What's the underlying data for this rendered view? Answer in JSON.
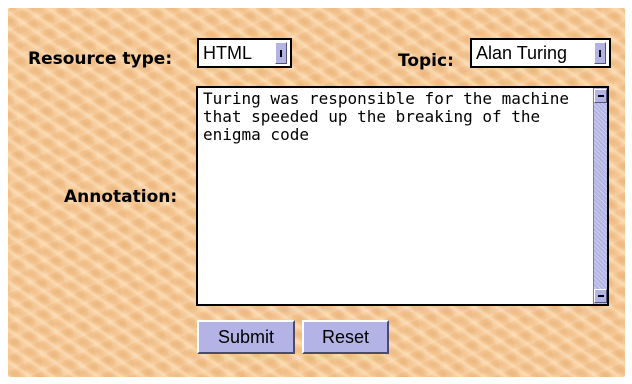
{
  "form": {
    "resource_type": {
      "label": "Resource type:",
      "selected": "HTML"
    },
    "topic": {
      "label": "Topic:",
      "selected": "Alan Turing"
    },
    "annotation": {
      "label": "Annotation:",
      "value": "Turing was responsible for the machine that speeded up the breaking of the enigma code"
    },
    "buttons": {
      "submit_label": "Submit",
      "reset_label": "Reset"
    }
  },
  "colors": {
    "background": "#f6c58f",
    "control_accent": "#b3b3e6"
  },
  "icons": {
    "select_arrow": "dropdown-arrow-icon",
    "scroll_up": "scroll-up-arrow-icon",
    "scroll_down": "scroll-down-arrow-icon"
  }
}
